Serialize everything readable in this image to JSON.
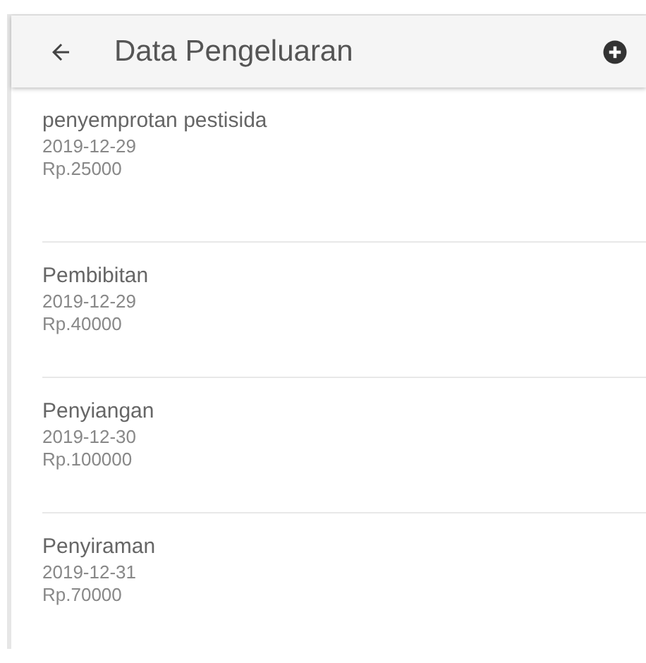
{
  "app_bar": {
    "title": "Data Pengeluaran"
  },
  "expenses": [
    {
      "name": "penyemprotan pestisida",
      "date": "2019-12-29",
      "amount": "Rp.25000"
    },
    {
      "name": "Pembibitan",
      "date": "2019-12-29",
      "amount": "Rp.40000"
    },
    {
      "name": "Penyiangan",
      "date": "2019-12-30",
      "amount": "Rp.100000"
    },
    {
      "name": "Penyiraman",
      "date": "2019-12-31",
      "amount": "Rp.70000"
    }
  ]
}
